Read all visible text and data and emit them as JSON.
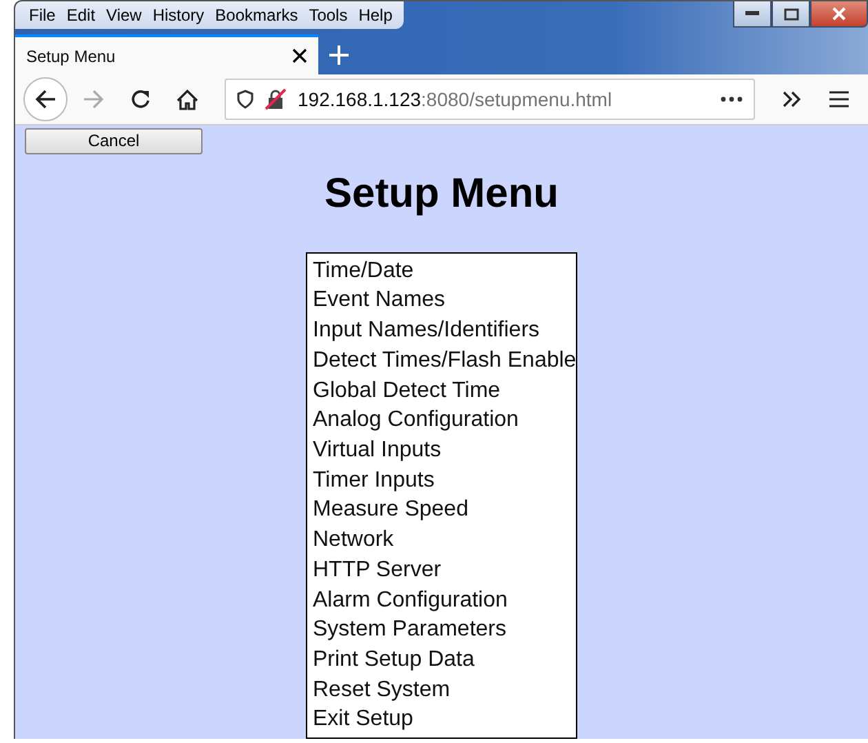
{
  "menu_bar": [
    "File",
    "Edit",
    "View",
    "History",
    "Bookmarks",
    "Tools",
    "Help"
  ],
  "tabs": [
    {
      "label": "Setup Menu",
      "selected": true
    }
  ],
  "address_bar": {
    "host": "192.168.1.123",
    "path": ":8080/setupmenu.html"
  },
  "cancel_button": "Cancel",
  "heading": "Setup Menu",
  "setup_menu": [
    "Time/Date",
    "Event Names",
    "Input Names/Identifiers",
    "Detect Times/Flash Enable",
    "Global Detect Time",
    "Analog Configuration",
    "Virtual Inputs",
    "Timer Inputs",
    "Measure Speed",
    "Network",
    "HTTP Server",
    "Alarm Configuration",
    "System Parameters",
    "Print Setup Data",
    "Reset System",
    "Exit Setup"
  ]
}
